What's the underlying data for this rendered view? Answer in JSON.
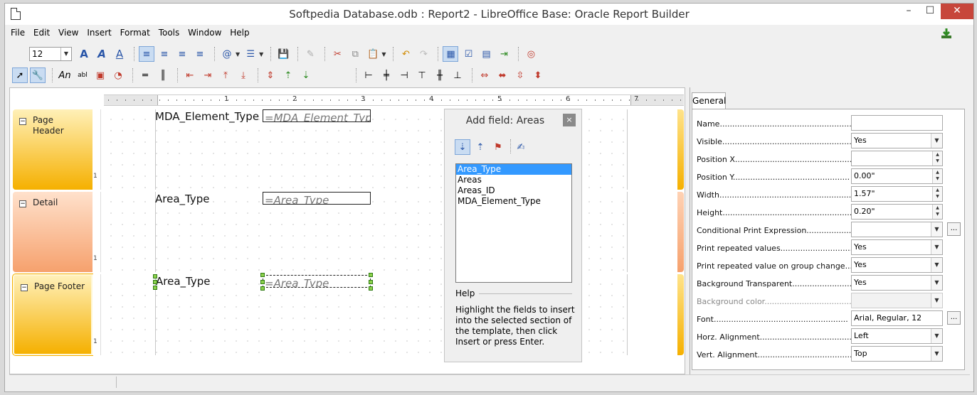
{
  "window": {
    "title": "Softpedia Database.odb : Report2 - LibreOffice Base: Oracle Report Builder"
  },
  "menu": [
    "File",
    "Edit",
    "View",
    "Insert",
    "Format",
    "Tools",
    "Window",
    "Help"
  ],
  "toolbar": {
    "font_size": "12"
  },
  "ruler": [
    "1",
    "2",
    "3",
    "4",
    "5",
    "6",
    "7"
  ],
  "sections": {
    "header": {
      "label": "Page Header",
      "field_label": "MDA_Element_Type",
      "field_value": "=MDA_Element_Type",
      "vruler": "1"
    },
    "detail": {
      "label": "Detail",
      "field_label": "Area_Type",
      "field_value": "=Area_Type",
      "vruler": "1"
    },
    "footer": {
      "label": "Page Footer",
      "field_label": "Area_Type",
      "field_value": "=Area_Type",
      "vruler": "1"
    }
  },
  "add_field": {
    "title": "Add field: Areas",
    "close": "×",
    "fields": [
      "Area_Type",
      "Areas",
      "Areas_ID",
      "MDA_Element_Type"
    ],
    "help_heading": "Help",
    "help_text": "Highlight the fields to insert into the selected section of the template, then click Insert or press Enter."
  },
  "properties": {
    "tab": "General",
    "rows": [
      {
        "label": "Name.....................................................",
        "value": ""
      },
      {
        "label": "Visible....................................................",
        "value": "Yes"
      },
      {
        "label": "Position X...............................................",
        "value": ""
      },
      {
        "label": "Position Y...............................................",
        "value": "0.00\""
      },
      {
        "label": "Width.....................................................",
        "value": "1.57\""
      },
      {
        "label": "Height....................................................",
        "value": "0.20\""
      },
      {
        "label": "Conditional Print Expression........................",
        "value": ""
      },
      {
        "label": "Print repeated values.................................",
        "value": "Yes"
      },
      {
        "label": "Print repeated value on group change...",
        "value": "Yes"
      },
      {
        "label": "Background Transparent...........................",
        "value": "Yes"
      },
      {
        "label": "Background color...........................................",
        "value": ""
      },
      {
        "label": "Font......................................................",
        "value": "Arial, Regular, 12"
      },
      {
        "label": "Horz. Alignment........................................",
        "value": "Left"
      },
      {
        "label": "Vert. Alignment.........................................",
        "value": "Top"
      }
    ]
  }
}
